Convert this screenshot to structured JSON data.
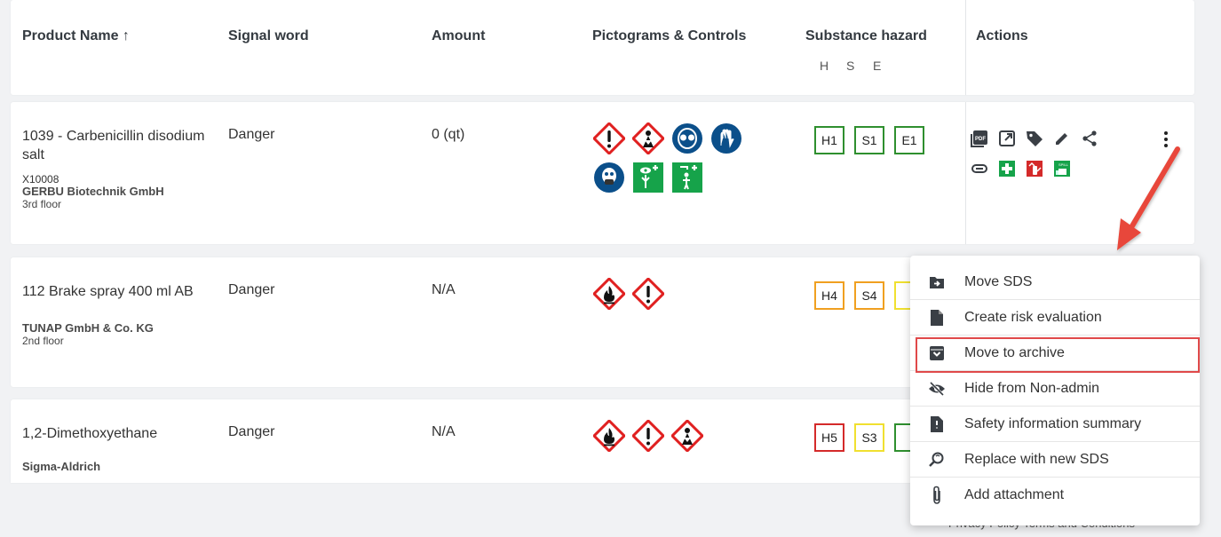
{
  "header": {
    "product_name": "Product Name",
    "sort_arrow": "↑",
    "signal_word": "Signal word",
    "amount": "Amount",
    "pictograms": "Pictograms & Controls",
    "substance_hazard": "Substance hazard",
    "h": "H",
    "s": "S",
    "e": "E",
    "actions": "Actions"
  },
  "rows": [
    {
      "name": "1039 - Carbenicillin disodium salt",
      "code": "X10008",
      "supplier": "GERBU Biotechnik GmbH",
      "location": "3rd floor",
      "signal": "Danger",
      "amount": "0 (qt)",
      "pictograms": [
        "exclamation-mark-pictogram",
        "health-hazard-pictogram",
        "eye-protection-icon",
        "hand-protection-icon",
        "respiratory-protection-icon",
        "eyewash-station-icon",
        "safety-shower-icon"
      ],
      "hazards": [
        {
          "label": "H1",
          "level": "green"
        },
        {
          "label": "S1",
          "level": "green"
        },
        {
          "label": "E1",
          "level": "green"
        }
      ]
    },
    {
      "name": "112 Brake spray 400 ml AB",
      "code": "",
      "supplier": "TUNAP GmbH & Co. KG",
      "location": "2nd floor",
      "signal": "Danger",
      "amount": "N/A",
      "pictograms": [
        "flammable-pictogram",
        "exclamation-mark-pictogram"
      ],
      "hazards": [
        {
          "label": "H4",
          "level": "orange"
        },
        {
          "label": "S4",
          "level": "orange"
        },
        {
          "label": "",
          "level": "yellow"
        }
      ]
    },
    {
      "name": "1,2-Dimethoxyethane",
      "code": "",
      "supplier": "Sigma-Aldrich",
      "location": "",
      "signal": "Danger",
      "amount": "N/A",
      "pictograms": [
        "flammable-pictogram",
        "exclamation-mark-pictogram",
        "health-hazard-pictogram"
      ],
      "hazards": [
        {
          "label": "H5",
          "level": "red"
        },
        {
          "label": "S3",
          "level": "yellow"
        },
        {
          "label": "",
          "level": "green"
        }
      ]
    }
  ],
  "actions": [
    "pdf-icon",
    "open-external-icon",
    "tag-icon",
    "edit-icon",
    "share-icon",
    "attachment-icon",
    "first-aid-icon",
    "fire-extinguisher-icon",
    "spill-kit-icon"
  ],
  "menu": {
    "items": [
      {
        "label": "Move SDS",
        "icon": "folder-move-icon"
      },
      {
        "label": "Create risk evaluation",
        "icon": "document-icon"
      },
      {
        "label": "Move to archive",
        "icon": "archive-icon"
      },
      {
        "label": "Hide from Non-admin",
        "icon": "eye-off-icon"
      },
      {
        "label": "Safety information summary",
        "icon": "summary-doc-icon"
      },
      {
        "label": "Replace with new SDS",
        "icon": "replace-search-icon"
      },
      {
        "label": "Add attachment",
        "icon": "paperclip-icon"
      }
    ]
  },
  "footer": {
    "text": "Privacy Policy    Terms and Conditions"
  },
  "colors": {
    "accent_red": "#e0494a",
    "danger_red": "#e02020",
    "safety_green": "#16a34a",
    "mandatory_blue": "#0b4f8a"
  }
}
